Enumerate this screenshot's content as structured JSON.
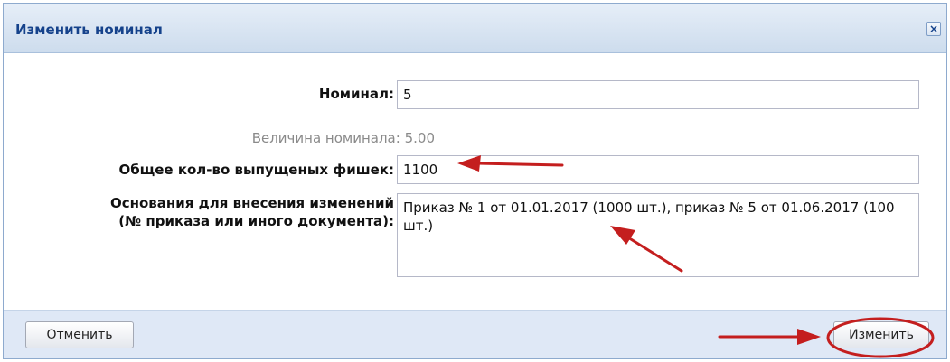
{
  "dialog": {
    "title": "Изменить номинал",
    "close_glyph": "×"
  },
  "form": {
    "nominal_label": "Номинал:",
    "nominal_value": "5",
    "nominal_size_label": "Величина номинала:",
    "nominal_size_value": "5.00",
    "total_chips_label": "Общее кол-во выпущеных фишек:",
    "total_chips_value": "1100",
    "basis_label_line1": "Основания для внесения изменений",
    "basis_label_line2": "(№ приказа или иного документа):",
    "basis_value": "Приказ № 1 от 01.01.2017 (1000 шт.), приказ № 5 от 01.06.2017 (100 шт.)"
  },
  "footer": {
    "cancel_label": "Отменить",
    "change_label": "Изменить"
  },
  "colors": {
    "title_text": "#15428b",
    "header_bg": "#dae6f4",
    "footer_bg": "#dfe8f6",
    "annotation_red": "#c41e1e"
  }
}
